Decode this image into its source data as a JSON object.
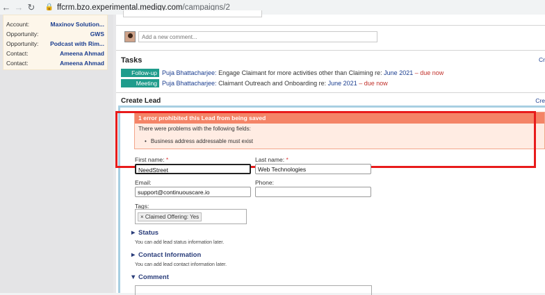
{
  "browser": {
    "back": "←",
    "forward": "→",
    "reload": "↻",
    "url_host": "ffcrm.bzo.experimental.medigy.com",
    "url_path": "/campaigns/2"
  },
  "sidebar": {
    "rows": [
      {
        "key": "Account:",
        "value": "Maxinov Solution..."
      },
      {
        "key": "Opportunity:",
        "value": "GWS"
      },
      {
        "key": "Opportunity:",
        "value": "Podcast with Rim..."
      },
      {
        "key": "Contact:",
        "value": "Ameena Ahmad"
      },
      {
        "key": "Contact:",
        "value": "Ameena Ahmad"
      }
    ]
  },
  "comment": {
    "placeholder": "Add a new comment..."
  },
  "tasks": {
    "title": "Tasks",
    "right_link": "Cr",
    "items": [
      {
        "badge": "Follow-up",
        "owner": "Puja Bhattacharjee:",
        "text": " Engage Claimant for more activities other than Claiming re: ",
        "link": "June 2021",
        "due": " – due now"
      },
      {
        "badge": "Meeting",
        "owner": "Puja Bhattacharjee:",
        "text": " Claimant Outreach and Onboarding re: ",
        "link": "June 2021",
        "due": " – due now"
      }
    ]
  },
  "create_lead": {
    "title": "Create Lead",
    "right_link": "Cre",
    "error": {
      "header": "1 error prohibited this Lead from being saved",
      "intro": "There were problems with the following fields:",
      "items": [
        "Business address addressable must exist"
      ]
    },
    "fields": {
      "first_name": {
        "label": "First name:",
        "required": "*",
        "value": "NeedStreet"
      },
      "last_name": {
        "label": "Last name:",
        "required": "*",
        "value": "Web Technologies"
      },
      "email": {
        "label": "Email:",
        "value": "support@continuouscare.io"
      },
      "phone": {
        "label": "Phone:",
        "value": ""
      },
      "tags": {
        "label": "Tags:",
        "chip": "× Claimed Offering: Yes"
      }
    },
    "sections": [
      {
        "arrow": "►",
        "title": "Status",
        "sub": "You can add lead status information later."
      },
      {
        "arrow": "►",
        "title": "Contact Information",
        "sub": "You can add lead contact information later."
      },
      {
        "arrow": "▼",
        "title": "Comment",
        "sub": ""
      }
    ]
  }
}
